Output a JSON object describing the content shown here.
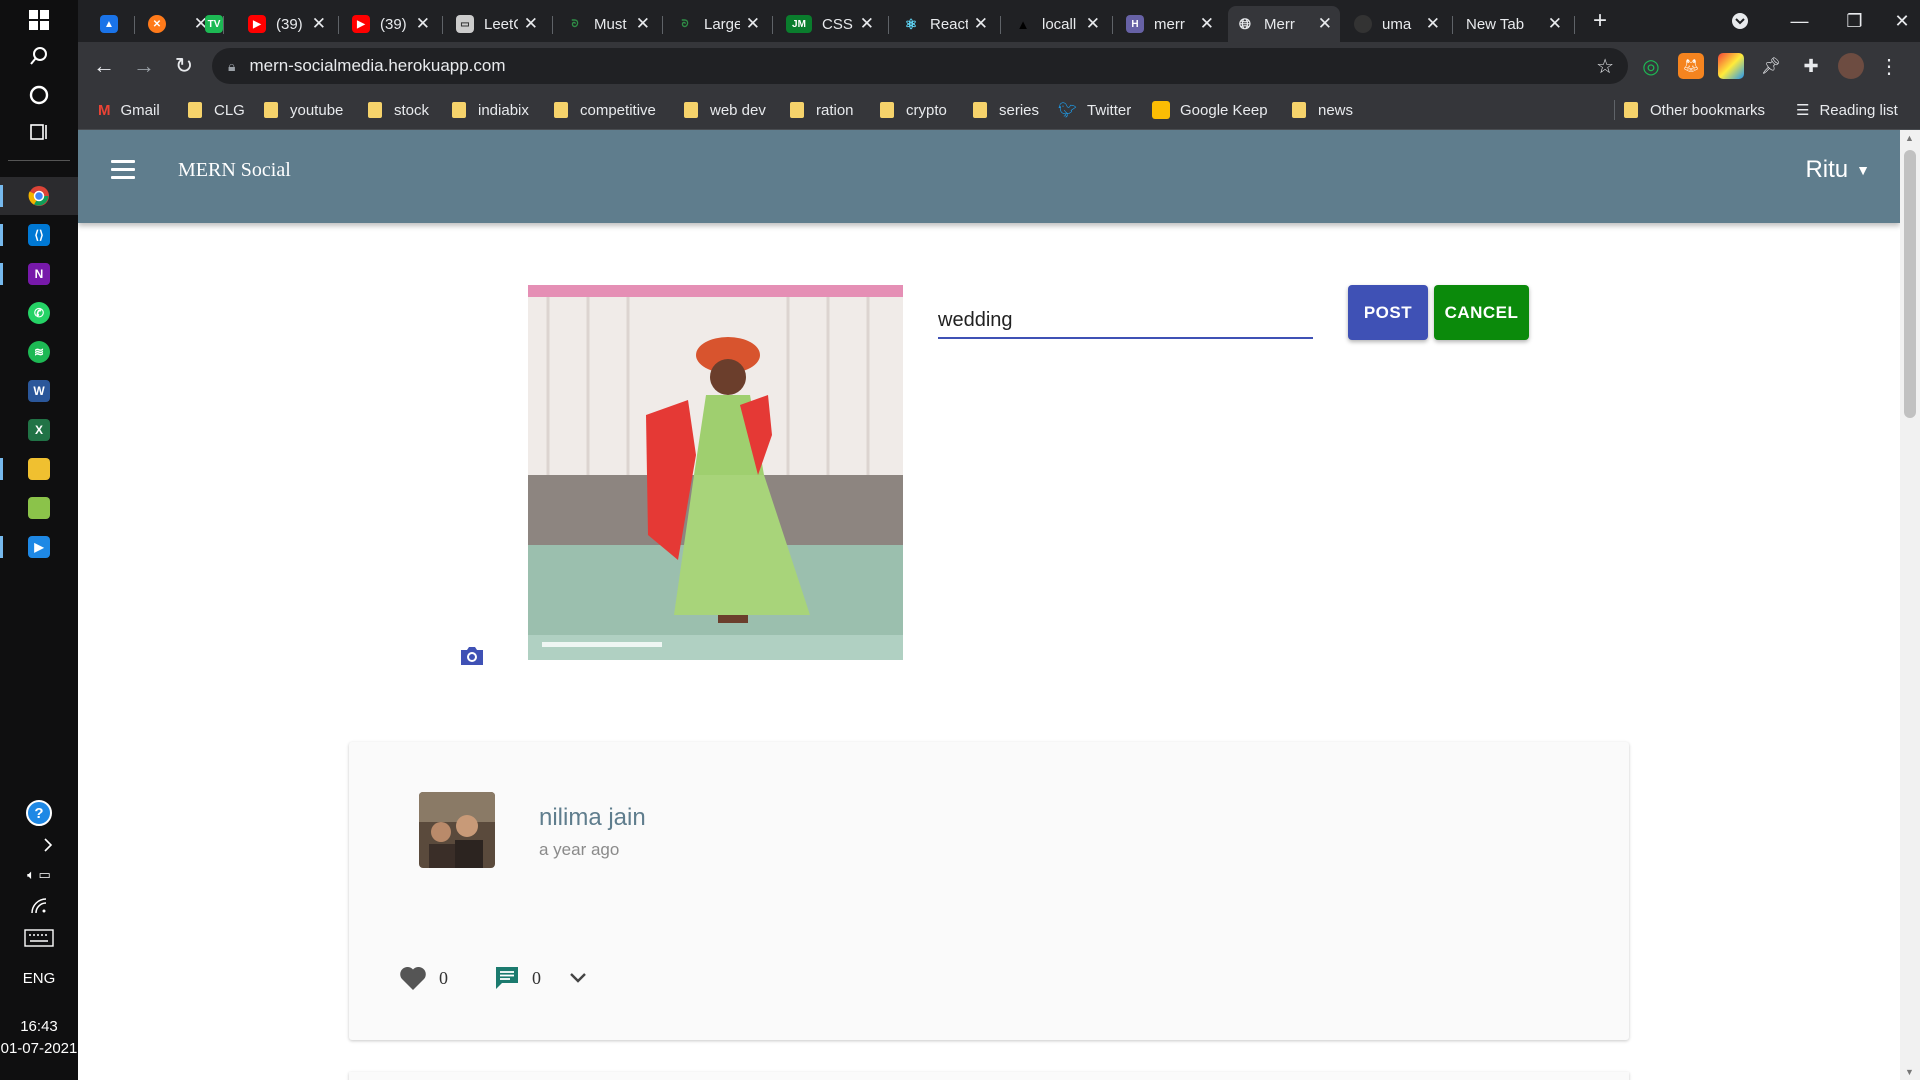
{
  "taskbar": {
    "language": "ENG",
    "time": "16:43",
    "date": "01-07-2021"
  },
  "tabs": [
    {
      "title": "",
      "favicon": "photos-icon",
      "color": "#1a73e8"
    },
    {
      "title": "",
      "favicon": "x-logo-icon",
      "color": "#ff7a1a"
    },
    {
      "title": "",
      "favicon": "tv-icon",
      "color": "#1db954"
    },
    {
      "title": "(39) (",
      "favicon": "youtube-icon",
      "color": "#ff0000"
    },
    {
      "title": "(39) \\",
      "favicon": "youtube-icon",
      "color": "#ff0000"
    },
    {
      "title": "LeetC",
      "favicon": "leetcode-icon",
      "color": "#cccccc"
    },
    {
      "title": "Must",
      "favicon": "gfg-icon",
      "color": "#2f8d46"
    },
    {
      "title": "Large",
      "favicon": "gfg-icon",
      "color": "#2f8d46"
    },
    {
      "title": "CSS \\",
      "favicon": "jm-icon",
      "color": "#0a7d2d"
    },
    {
      "title": "React",
      "favicon": "react-icon",
      "color": "#61dafb"
    },
    {
      "title": "locall",
      "favicon": "vercel-icon",
      "color": "#000000"
    },
    {
      "title": "merr",
      "favicon": "heroku-icon",
      "color": "#6762a6"
    },
    {
      "title": "Merr",
      "favicon": "globe-icon",
      "color": "#9aa0a6",
      "active": true
    },
    {
      "title": "uma",
      "favicon": "github-icon",
      "color": "#333333"
    },
    {
      "title": "New Tab",
      "favicon": "",
      "color": ""
    }
  ],
  "toolbar": {
    "url": "mern-socialmedia.herokuapp.com"
  },
  "bookmarks": [
    {
      "label": "Gmail",
      "icon": "gmail-icon"
    },
    {
      "label": "CLG",
      "icon": "folder-icon"
    },
    {
      "label": "youtube",
      "icon": "folder-icon"
    },
    {
      "label": "stock",
      "icon": "folder-icon"
    },
    {
      "label": "indiabix",
      "icon": "folder-icon"
    },
    {
      "label": "competitive",
      "icon": "folder-icon"
    },
    {
      "label": "web dev",
      "icon": "folder-icon"
    },
    {
      "label": "ration",
      "icon": "folder-icon"
    },
    {
      "label": "crypto",
      "icon": "folder-icon"
    },
    {
      "label": "series",
      "icon": "folder-icon"
    },
    {
      "label": "Twitter",
      "icon": "twitter-icon"
    },
    {
      "label": "Google Keep",
      "icon": "keep-icon"
    },
    {
      "label": "news",
      "icon": "folder-icon"
    }
  ],
  "bookmarks_right": {
    "other": "Other bookmarks",
    "reading": "Reading list"
  },
  "app": {
    "brand": "MERN Social",
    "user": "Ritu",
    "bar_color": "#5f7d8d"
  },
  "new_post": {
    "caption_value": "wedding",
    "post_label": "POST",
    "cancel_label": "CANCEL",
    "post_color": "#3f51b5",
    "cancel_color": "#0b8a0b"
  },
  "post": {
    "author": "nilima jain",
    "time": "a year ago",
    "likes": "0",
    "comments": "0"
  }
}
